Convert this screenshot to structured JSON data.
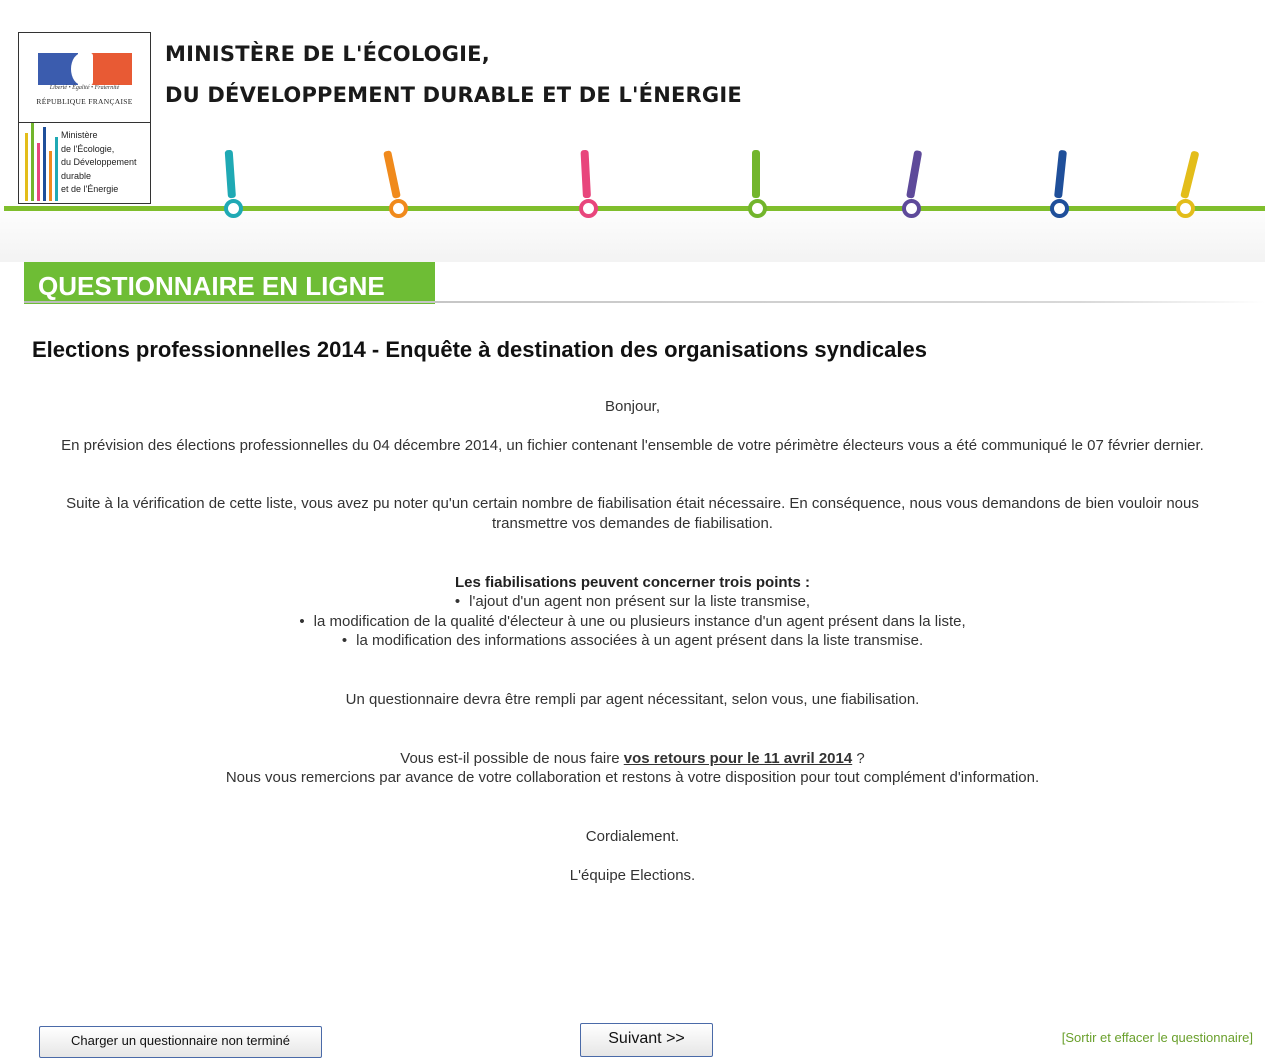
{
  "header": {
    "ministry_line1": "MINISTÈRE DE L'ÉCOLOGIE,",
    "ministry_line2": "DU DÉVELOPPEMENT DURABLE ET DE L'ÉNERGIE",
    "logo_motto": "Liberté • Égalité • Fraternité",
    "logo_republique": "RÉPUBLIQUE FRANÇAISE",
    "logo_ministry_lines": [
      "Ministère",
      "de l'Écologie,",
      "du Développement",
      "durable",
      "et de l'Énergie"
    ],
    "accent_green": "#7fbe2c",
    "pin_colors": [
      "#1fa9b4",
      "#f08a1c",
      "#e8467c",
      "#72b52c",
      "#5e4a9a",
      "#1f4f9a",
      "#e3bd1a"
    ]
  },
  "banner": {
    "label": "QUESTIONNAIRE EN LIGNE",
    "color": "#6ebd35"
  },
  "page_title": "Elections professionnelles 2014 - Enquête à destination des organisations syndicales",
  "body": {
    "greeting": "Bonjour,",
    "para1": "En prévision des élections professionnelles du 04 décembre 2014, un fichier contenant l'ensemble de votre périmètre électeurs vous a été communiqué le 07 février dernier.",
    "para2_line1": "Suite à la vérification de cette liste, vous avez pu noter qu'un certain nombre de fiabilisation était nécessaire. En conséquence, nous vous demandons de bien vouloir nous",
    "para2_line2": "transmettre vos demandes de fiabilisation.",
    "points_heading": "Les fiabilisations peuvent concerner trois points :",
    "points": [
      "l'ajout d'un agent non présent sur la liste transmise,",
      "la modification de la qualité d'électeur à une ou plusieurs instance d'un agent présent dans la liste,",
      "la modification des informations associées à un agent présent dans la liste transmise."
    ],
    "para3": "Un questionnaire devra être rempli par agent nécessitant, selon vous, une fiabilisation.",
    "para4_prefix": "Vous est-il possible de nous faire ",
    "para4_link": "vos retours pour le 11 avril 2014",
    "para4_suffix": " ?",
    "para5": "Nous vous remercions par avance de votre collaboration et restons à votre disposition pour tout complément d'information.",
    "closing": "Cordialement.",
    "signature": "L'équipe Elections."
  },
  "footer": {
    "load_button": "Charger un questionnaire non terminé",
    "next_button": "Suivant >>",
    "exit_link": "[Sortir et effacer le questionnaire]"
  }
}
